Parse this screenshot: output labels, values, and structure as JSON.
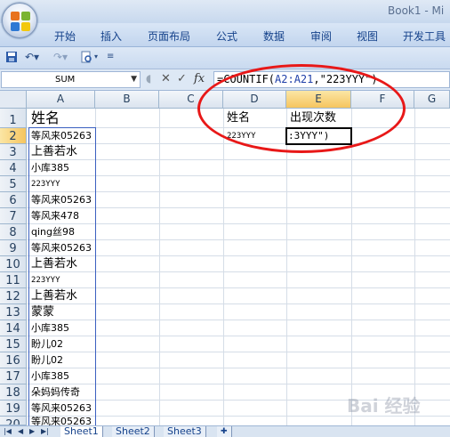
{
  "window": {
    "title": "Book1 - Mi"
  },
  "ribbon": {
    "tabs": [
      "开始",
      "插入",
      "页面布局",
      "公式",
      "数据",
      "审阅",
      "视图",
      "开发工具"
    ]
  },
  "formula_bar": {
    "name_box": "SUM",
    "formula_prefix": "=COUNTIF(",
    "formula_ref": "A2:A21",
    "formula_suffix": ",\"223YYY\")",
    "cancel_symbol": "✕",
    "enter_symbol": "✓",
    "fx_symbol": "fx"
  },
  "grid": {
    "columns": [
      "A",
      "B",
      "C",
      "D",
      "E",
      "F",
      "G"
    ],
    "rows": [
      "1",
      "2",
      "3",
      "4",
      "5",
      "6",
      "7",
      "8",
      "9",
      "10",
      "11",
      "12",
      "13",
      "14",
      "15",
      "16",
      "17",
      "18",
      "19",
      "20"
    ],
    "column_a": [
      "姓名",
      "等风来05263",
      "上善若水",
      "小库385",
      "223YYY",
      "等风来05263",
      "等风来478",
      "qing丝98",
      "等风来05263",
      "上善若水",
      "223YYY",
      "上善若水",
      "蒙蒙",
      "小库385",
      "盼儿02",
      "盼儿02",
      "小库385",
      "朵妈妈传奇",
      "等风来05263",
      "等风来05263"
    ],
    "d1": "姓名",
    "e1": "出现次数",
    "d2": "223YYY",
    "e2_editing": ":3YYY\")"
  },
  "sheets": [
    "Sheet1",
    "Sheet2",
    "Sheet3"
  ],
  "watermark": "Bai 经验"
}
